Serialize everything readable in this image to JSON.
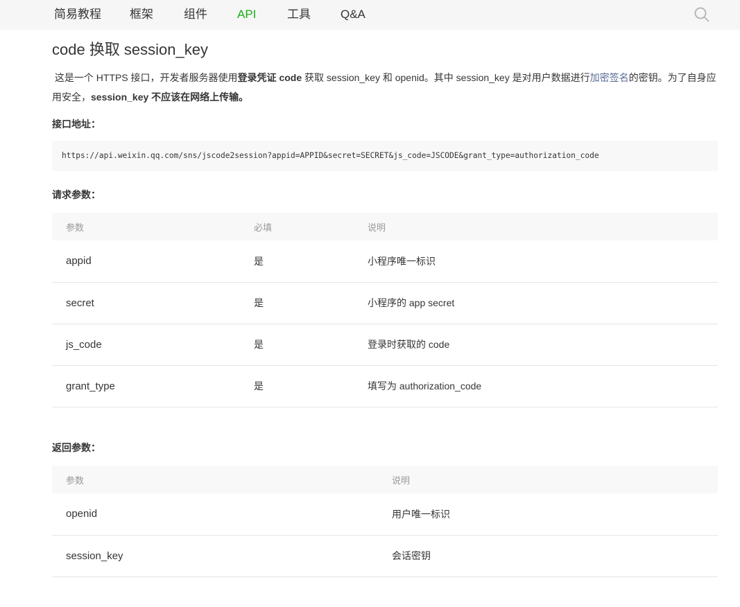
{
  "nav": {
    "items": [
      {
        "label": "简易教程"
      },
      {
        "label": "框架"
      },
      {
        "label": "组件"
      },
      {
        "label": "API"
      },
      {
        "label": "工具"
      },
      {
        "label": "Q&A"
      }
    ],
    "active": "API",
    "colors": {
      "active": "#1aad19",
      "background": "#f6f6f6"
    }
  },
  "page": {
    "title": "code 换取 session_key",
    "intro": {
      "part1": "这是一个 HTTPS 接口，开发者服务器使用",
      "bold1": "登录凭证 code",
      "part2": " 获取 session_key 和 openid。其中 session_key 是对用户数据进行",
      "link": "加密签名",
      "part3": "的密钥。为了自身应用安全，",
      "bold2": "session_key 不应该在网络上传输。"
    }
  },
  "endpoint": {
    "label": "接口地址：",
    "url": "https://api.weixin.qq.com/sns/jscode2session?appid=APPID&secret=SECRET&js_code=JSCODE&grant_type=authorization_code"
  },
  "request_params": {
    "label": "请求参数：",
    "headers": {
      "param": "参数",
      "required": "必填",
      "desc": "说明"
    },
    "rows": [
      {
        "param": "appid",
        "required": "是",
        "desc": "小程序唯一标识"
      },
      {
        "param": "secret",
        "required": "是",
        "desc": "小程序的 app secret"
      },
      {
        "param": "js_code",
        "required": "是",
        "desc": "登录时获取的 code"
      },
      {
        "param": "grant_type",
        "required": "是",
        "desc": "填写为 authorization_code"
      }
    ]
  },
  "response_params": {
    "label": "返回参数：",
    "headers": {
      "param": "参数",
      "desc": "说明"
    },
    "rows": [
      {
        "param": "openid",
        "desc": "用户唯一标识"
      },
      {
        "param": "session_key",
        "desc": "会话密钥"
      }
    ]
  },
  "colors": {
    "link": "#576b95",
    "text": "#353535",
    "header_text": "#999999"
  }
}
